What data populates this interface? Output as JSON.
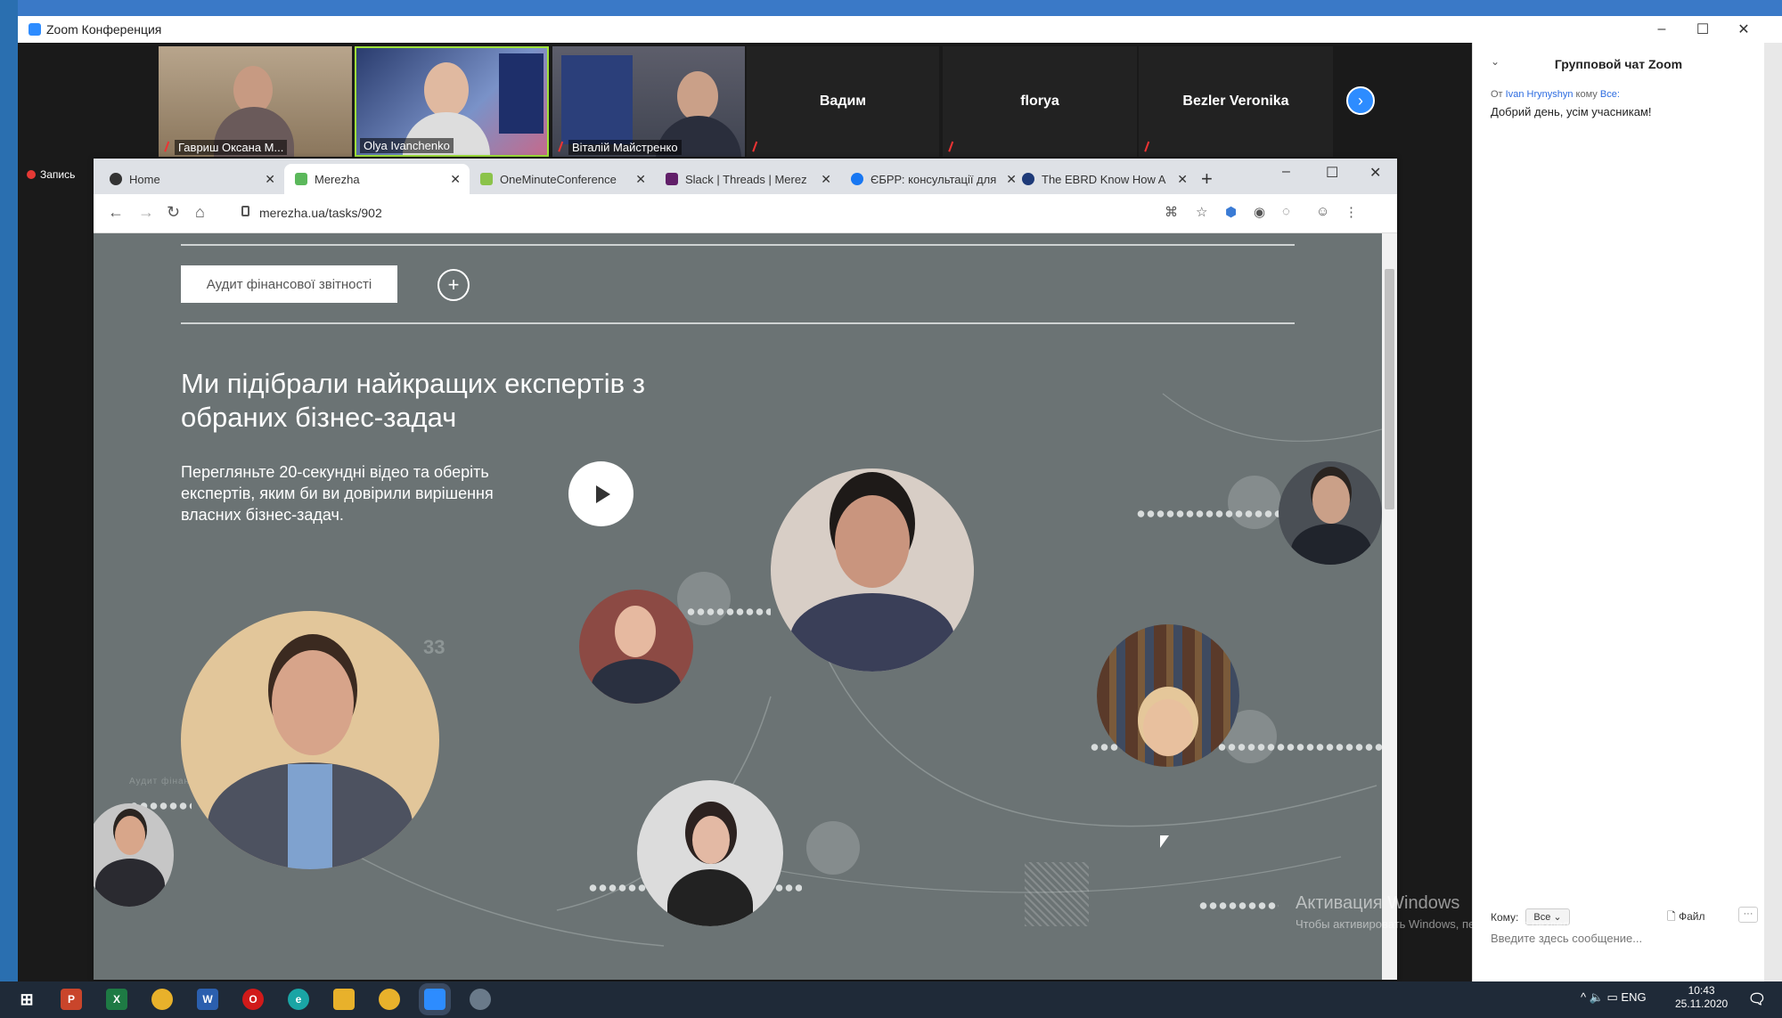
{
  "zoom": {
    "title": "Zoom Конференция",
    "recording": "Запись",
    "participants": [
      {
        "name": "Гавриш Оксана М..."
      },
      {
        "name": "Olya Ivanchenko"
      },
      {
        "name": "Віталій Майстренко"
      },
      {
        "name": "Вадим"
      },
      {
        "name": "florya"
      },
      {
        "name": "Bezler Veronika"
      }
    ]
  },
  "chat": {
    "title": "Групповой чат Zoom",
    "from_prefix": "От",
    "from": "Ivan Hrynyshyn",
    "to_word": "кому",
    "to_all": "Все:",
    "message": "Добрий день, усім учасникам!",
    "to_label": "Кому:",
    "to_select": "Все",
    "file_label": "Файл",
    "more": "···",
    "input_placeholder": "Введите здесь сообщение..."
  },
  "browser": {
    "tabs": [
      {
        "label": "Home"
      },
      {
        "label": "Merezha"
      },
      {
        "label": "OneMinuteConference"
      },
      {
        "label": "Slack | Threads | Merez"
      },
      {
        "label": "ЄБРР: консультації для"
      },
      {
        "label": "The EBRD Know How A"
      }
    ],
    "url": "merezha.ua/tasks/902"
  },
  "page": {
    "chip": "Аудит фінансової звітності",
    "headline": "Ми підібрали найкращих експертів з обраних бізнес-задач",
    "subtext": "Перегляньте 20-секундні відео та оберіть експертів, яким би ви довірили вирішення власних бізнес-задач.",
    "number": "33",
    "small_tag": "Аудит фінансової звітн"
  },
  "windows": {
    "activation_title": "Активация Windows",
    "activation_text": "Чтобы активировать Windows, перейдите в раздел \"Параметры\".",
    "lang": "ENG",
    "time": "10:43",
    "date": "25.11.2020"
  },
  "colors": {
    "zoom_blue": "#2d8cff",
    "page_bg": "#6b7374",
    "taskbar": "#1f2a38"
  }
}
